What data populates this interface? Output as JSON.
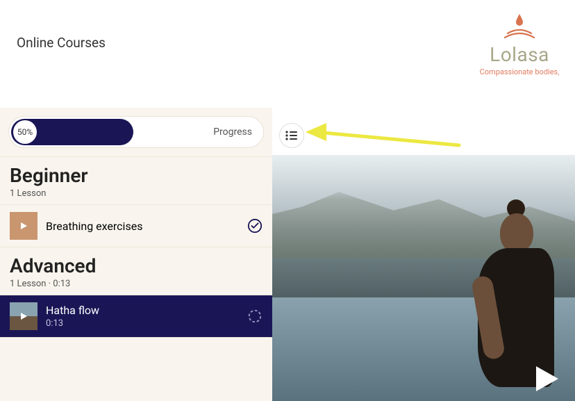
{
  "header": {
    "title": "Online Courses",
    "brand": "Lolasa",
    "tagline": "Compassionate bodies,"
  },
  "progress": {
    "percent": "50%",
    "label": "Progress"
  },
  "sections": [
    {
      "title": "Beginner",
      "meta": "1 Lesson",
      "lessons": [
        {
          "title": "Breathing exercises",
          "duration": "",
          "completed": true
        }
      ]
    },
    {
      "title": "Advanced",
      "meta": "1 Lesson · 0:13",
      "lessons": [
        {
          "title": "Hatha flow",
          "duration": "0:13",
          "completed": false,
          "active": true
        }
      ]
    }
  ],
  "colors": {
    "accent": "#1a1656",
    "brand": "#a9a78a",
    "tagline": "#e07b5f",
    "arrow": "#ece842"
  }
}
